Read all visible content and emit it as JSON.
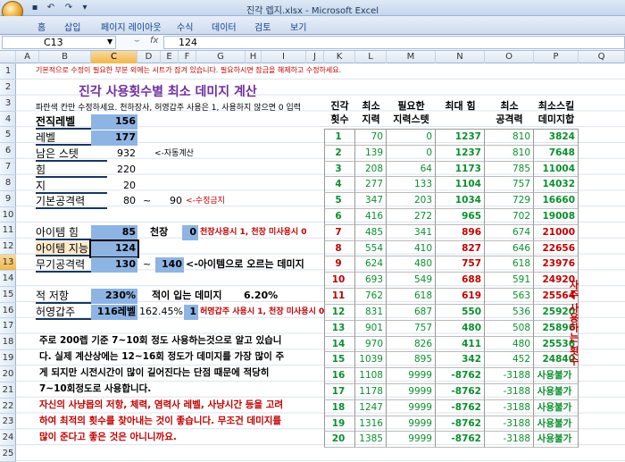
{
  "window": {
    "title": "진각 렙지.xlsx - Microsoft Excel"
  },
  "ribbon": {
    "tabs": [
      "홈",
      "삽입",
      "페이지 레이아웃",
      "수식",
      "데이터",
      "검토",
      "보기"
    ]
  },
  "formula": {
    "cell_ref": "C13",
    "fx": "fx",
    "value": "124"
  },
  "columns": [
    "A",
    "B",
    "C",
    "D",
    "E",
    "F",
    "G",
    "H",
    "I",
    "J",
    "K",
    "L",
    "M",
    "N",
    "O",
    "P",
    "Q"
  ],
  "rows": [
    "1",
    "2",
    "3",
    "4",
    "5",
    "6",
    "7",
    "8",
    "9",
    "10",
    "11",
    "12",
    "13",
    "14",
    "15",
    "16",
    "17",
    "18",
    "19",
    "20",
    "21",
    "22",
    "23",
    "24",
    "25"
  ],
  "sheet": {
    "note1": "기본적으로 수정이 필요한 부분 외에는 시트가 잠겨 있습니다. 필요하시면 잠금을 해제하고 수정하세요.",
    "title": "진각 사용횟수별 최소 데미지 계산",
    "note2": "파란색 칸만 수정하세요. 천하장사, 허영갑주 사용은 1, 사용하지 않으면 0 입력",
    "l5": "전직레벨",
    "v5": "156",
    "l6": "레벨",
    "v6": "177",
    "l7": "남은 스텟",
    "v7": "932",
    "n7": "<-자동계산",
    "l8": "힘",
    "v8": "220",
    "l9": "지",
    "v9": "20",
    "l10": "기본공격력",
    "v10a": "80",
    "tilde": "~",
    "v10b": "90",
    "n10": "<-수정금지",
    "l12": "아이템 힘",
    "v12": "85",
    "c12": "천장",
    "v12b": "0",
    "n12": "천장사용시 1, 천장 미사용시 0",
    "l13": "아이템 지능",
    "v13": "124",
    "l14": "무기공격력",
    "v14a": "130",
    "v14b": "140",
    "n14": "<-아이템으로 오르는 데미지",
    "l16": "적 저항",
    "v16": "230%",
    "c16": "적이 입는 데미지",
    "v16b": "6.20%",
    "l17": "허영갑주",
    "v17": "116레벨",
    "v17b": "162.45%",
    "v17c": "1",
    "n17": "허영갑주 사용시 1, 천장 미사용시 0",
    "para1": [
      "주로 200렙 기준 7~10회 정도 사용하는것으로 알고 있습니",
      "다. 실제 계산상에는 12~16회 정도가 데미지를 가장 많이 주",
      "게 되지만 시전시간이 많이 길어진다는 단점 때문에 적당히",
      "7~10회정도로 사용합니다."
    ],
    "para2": [
      "자신의 사냥몹의 저항, 체력, 염력사 레벨, 사냥시간 등을 고려",
      "하여 최적의 횟수를 찾아내는 것이 좋습니다. 무조건 데미지를",
      "많이 준다고 좋은 것은 아니니까요."
    ],
    "side_note": "자주 사용하는 횟수"
  },
  "table": {
    "headers": [
      "진각\n횟수",
      "최소\n지력",
      "필요한\n지력스텟",
      "최대 힘",
      "최소\n공격력",
      "최소스킬\n데미지합"
    ],
    "rows": [
      [
        "1",
        "70",
        "0",
        "1237",
        "810",
        "3824"
      ],
      [
        "2",
        "139",
        "0",
        "1237",
        "810",
        "7648"
      ],
      [
        "3",
        "208",
        "64",
        "1173",
        "785",
        "11004"
      ],
      [
        "4",
        "277",
        "133",
        "1104",
        "757",
        "14032"
      ],
      [
        "5",
        "347",
        "203",
        "1034",
        "729",
        "16660"
      ],
      [
        "6",
        "416",
        "272",
        "965",
        "702",
        "19008"
      ],
      [
        "7",
        "485",
        "341",
        "896",
        "674",
        "21000"
      ],
      [
        "8",
        "554",
        "410",
        "827",
        "646",
        "22656"
      ],
      [
        "9",
        "624",
        "480",
        "757",
        "618",
        "23976"
      ],
      [
        "10",
        "693",
        "549",
        "688",
        "591",
        "24920"
      ],
      [
        "11",
        "762",
        "618",
        "619",
        "563",
        "25564"
      ],
      [
        "12",
        "831",
        "687",
        "550",
        "536",
        "25920"
      ],
      [
        "13",
        "901",
        "757",
        "480",
        "508",
        "25896"
      ],
      [
        "14",
        "970",
        "826",
        "411",
        "480",
        "25536"
      ],
      [
        "15",
        "1039",
        "895",
        "342",
        "452",
        "24840"
      ],
      [
        "16",
        "1108",
        "9999",
        "-8762",
        "-3188",
        "사용불가"
      ],
      [
        "17",
        "1178",
        "9999",
        "-8762",
        "-3188",
        "사용불가"
      ],
      [
        "18",
        "1247",
        "9999",
        "-8762",
        "-3188",
        "사용불가"
      ],
      [
        "19",
        "1316",
        "9999",
        "-8762",
        "-3188",
        "사용불가"
      ],
      [
        "20",
        "1385",
        "9999",
        "-8762",
        "-3188",
        "사용불가"
      ]
    ]
  },
  "colors": {
    "highlight_rows_red": [
      7,
      8,
      9,
      10,
      11
    ]
  }
}
